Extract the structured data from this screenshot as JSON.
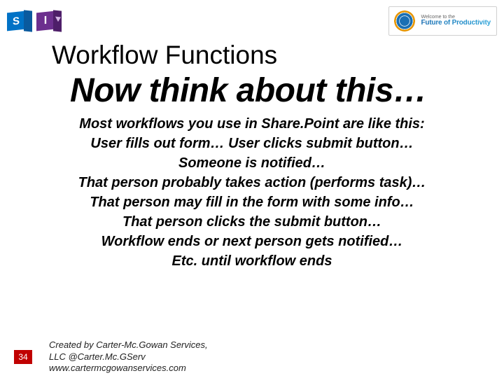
{
  "header": {
    "sharepoint_letter": "S",
    "infopath_letter": "I",
    "logo_small": "Welcome to the",
    "logo_big": "Future of Productivity"
  },
  "title": "Workflow Functions",
  "subtitle": "Now think about this…",
  "body": {
    "l1": "Most workflows you use in Share.Point are like this:",
    "l2": "User fills out form… User clicks submit button…",
    "l3": "Someone is notified…",
    "l4": "That person probably takes action (performs task)…",
    "l5": "That person may fill in the form with some info…",
    "l6": "That person clicks the submit button…",
    "l7": "Workflow ends or next person gets notified…",
    "l8": "Etc. until workflow ends"
  },
  "footer": {
    "page": "34",
    "credit1": "Created by Carter-Mc.Gowan Services,",
    "credit2": "LLC     @Carter.Mc.GServ",
    "credit3": "www.cartermcgowanservices.com"
  }
}
